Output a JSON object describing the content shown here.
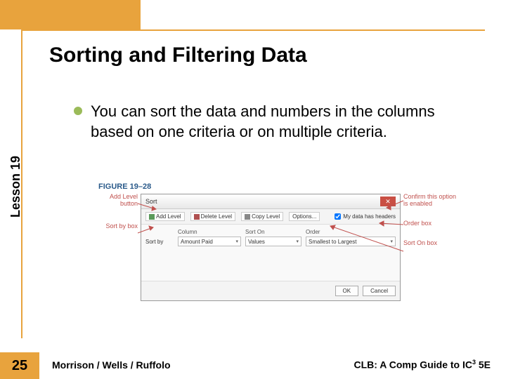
{
  "slide": {
    "title": "Sorting and Filtering Data",
    "lesson_label": "Lesson 19",
    "page_number": "25",
    "footer_left": "Morrison / Wells / Ruffolo",
    "footer_right_a": "CLB: A Comp Guide to IC",
    "footer_right_sup": "3",
    "footer_right_b": " 5E",
    "bullet": "You can sort the data and numbers in the columns based on one criteria or on multiple criteria."
  },
  "figure": {
    "label": "FIGURE 19–28",
    "callouts": {
      "left1": "Add Level button",
      "left2": "Sort by box",
      "right1": "Confirm this option is enabled",
      "right2": "Order box",
      "right3": "Sort On box"
    },
    "dialog": {
      "title": "Sort",
      "toolbar": {
        "add": "Add Level",
        "delete": "Delete Level",
        "copy": "Copy Level",
        "options": "Options...",
        "headers_label": "My data has headers"
      },
      "headers": {
        "column": "Column",
        "sorton": "Sort On",
        "order": "Order"
      },
      "row": {
        "label": "Sort by",
        "column_value": "Amount Paid",
        "sorton_value": "Values",
        "order_value": "Smallest to Largest"
      },
      "footer": {
        "ok": "OK",
        "cancel": "Cancel"
      }
    }
  }
}
